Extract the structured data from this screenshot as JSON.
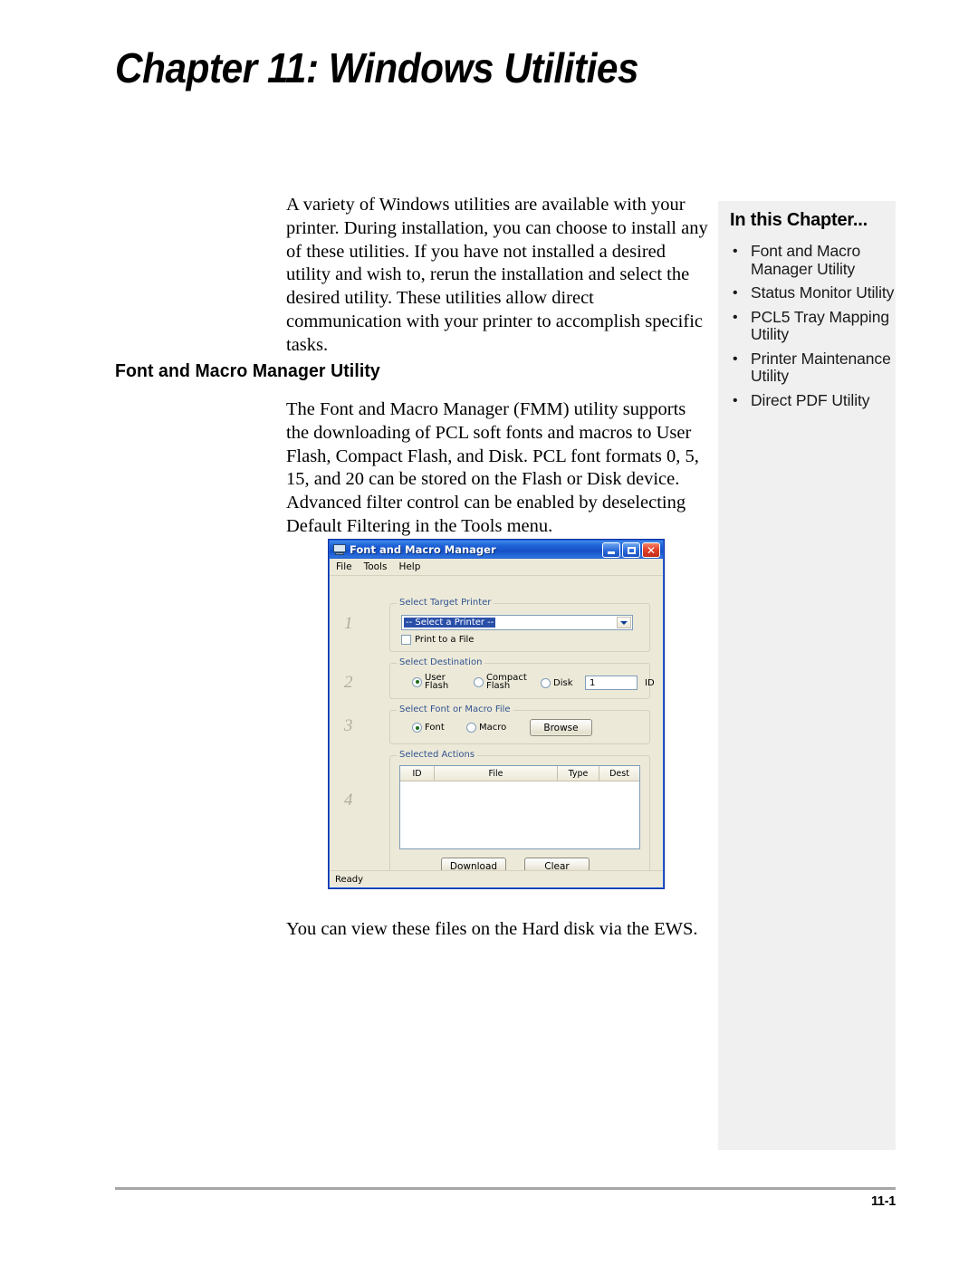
{
  "page": {
    "chapter_title": "Chapter 11: Windows Utilities",
    "footer_page_number": "11-1"
  },
  "content": {
    "intro_paragraph": "A variety of Windows utilities are available with your printer. During installation, you can choose to install any of these utilities. If you have not installed a desired utility and wish to, rerun the installation and select the desired utility. These utilities allow direct communication with your printer to accomplish specific tasks.",
    "section_heading": "Font and Macro Manager Utility",
    "section_paragraph": "The Font and Macro Manager (FMM) utility supports the downloading of PCL soft fonts and macros to User Flash, Compact Flash, and Disk. PCL font formats 0, 5, 15, and 20 can be stored on the Flash or Disk device. Advanced filter control can be enabled by deselecting Default Filtering in the Tools menu.",
    "closing_paragraph": "You can view these files on the Hard disk via the EWS."
  },
  "sidebar": {
    "title": "In this Chapter...",
    "bullet_glyph": "•",
    "items": [
      {
        "label": "Font and Macro Manager Utility"
      },
      {
        "label": "Status Monitor Utility"
      },
      {
        "label": "PCL5 Tray Mapping Utility"
      },
      {
        "label": "Printer Maintenance Utility"
      },
      {
        "label": "Direct PDF Utility"
      }
    ]
  },
  "dialog": {
    "title": "Font and Macro Manager",
    "title_icon": "computer-icon",
    "window_buttons": {
      "minimize": "minimize-icon",
      "maximize": "maximize-icon",
      "close": "✕"
    },
    "menu": [
      {
        "label": "File"
      },
      {
        "label": "Tools"
      },
      {
        "label": "Help"
      }
    ],
    "steps": [
      "1",
      "2",
      "3",
      "4"
    ],
    "group_target_printer": {
      "label": "Select Target Printer",
      "combo_value": "-- Select a Printer --",
      "checkbox_label": "Print to a File",
      "checkbox_checked": false
    },
    "group_destination": {
      "label": "Select Destination",
      "options": [
        {
          "label_line1": "User",
          "label_line2": "Flash",
          "selected": true
        },
        {
          "label_line1": "Compact",
          "label_line2": "Flash",
          "selected": false
        },
        {
          "label_line1": "Disk",
          "label_line2": "",
          "selected": false
        }
      ],
      "id_value": "1",
      "id_label": "ID"
    },
    "group_font_macro": {
      "label": "Select Font or Macro File",
      "options": [
        {
          "label": "Font",
          "selected": true
        },
        {
          "label": "Macro",
          "selected": false
        }
      ],
      "browse_label": "Browse"
    },
    "group_actions": {
      "label": "Selected Actions",
      "columns": [
        "ID",
        "File",
        "Type",
        "Dest"
      ],
      "rows": []
    },
    "buttons": {
      "download_label": "Download",
      "clear_label": "Clear"
    },
    "status_text": "Ready"
  }
}
